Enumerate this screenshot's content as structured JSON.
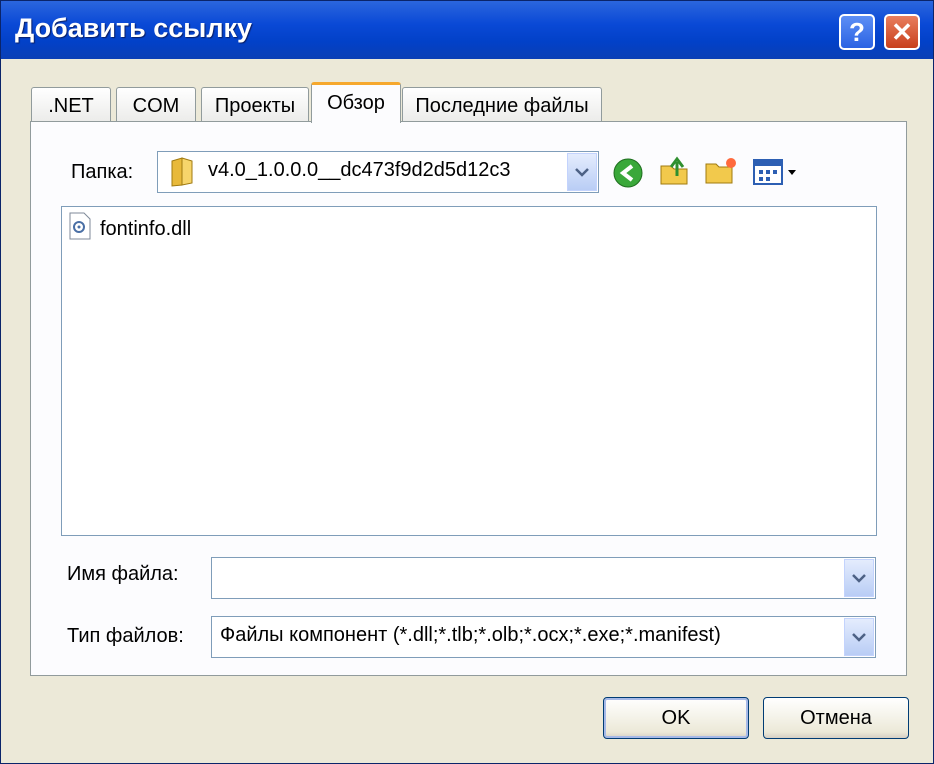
{
  "window": {
    "title": "Добавить ссылку",
    "help_glyph": "?",
    "close_glyph": "✕"
  },
  "tabs": [
    {
      "label": ".NET"
    },
    {
      "label": "COM"
    },
    {
      "label": "Проекты"
    },
    {
      "label": "Обзор",
      "active": true
    },
    {
      "label": "Последние файлы"
    }
  ],
  "folder": {
    "label": "Папка:",
    "value": "v4.0_1.0.0.0__dc473f9d2d5d12c3",
    "toolbar_icons": [
      "back-icon",
      "up-folder-icon",
      "new-folder-icon",
      "view-menu-icon"
    ]
  },
  "files": [
    {
      "name": "fontinfo.dll",
      "icon": "dll-file-icon"
    }
  ],
  "filename": {
    "label": "Имя файла:",
    "value": ""
  },
  "filetype": {
    "label": "Тип файлов:",
    "value": "Файлы компонент (*.dll;*.tlb;*.olb;*.ocx;*.exe;*.manifest)"
  },
  "buttons": {
    "ok": "OK",
    "cancel": "Отмена"
  },
  "colors": {
    "titlebar": "#0a49d6",
    "active_tab_accent": "#f6a82d",
    "dialog_bg": "#ece9d8"
  }
}
